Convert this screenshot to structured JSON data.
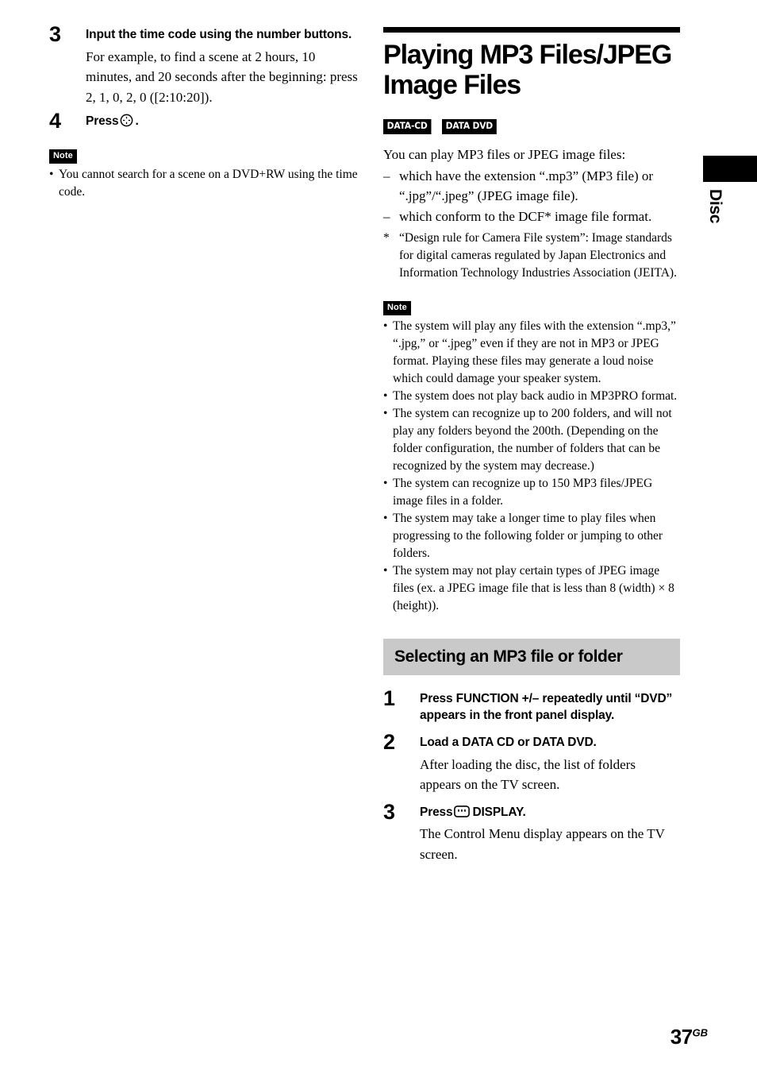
{
  "page": {
    "number": "37",
    "number_suffix": "GB"
  },
  "side_tab": {
    "label": "Disc"
  },
  "left_column": {
    "steps": [
      {
        "number": "3",
        "title": "Input the time code using the number buttons.",
        "body": "For example, to find a scene at 2 hours, 10 minutes, and 20 seconds after the beginning: press 2, 1, 0, 2, 0 ([2:10:20])."
      },
      {
        "number": "4",
        "title_prefix": "Press",
        "title_suffix": ".",
        "icon": "enter-button-icon"
      }
    ],
    "note": {
      "badge": "Note",
      "items": [
        "You cannot search for a scene on a DVD+RW using the time code."
      ]
    }
  },
  "right_column": {
    "section_title": "Playing MP3 Files/JPEG Image Files",
    "media_badges": [
      "DATA-CD",
      "DATA DVD"
    ],
    "intro": "You can play MP3 files or JPEG image files:",
    "dash_items": [
      "which have the extension “.mp3” (MP3 file) or “.jpg”/“.jpeg” (JPEG image file).",
      "which conform to the DCF* image file format."
    ],
    "footnote_marker": "*",
    "footnote": "“Design rule for Camera File system”: Image standards for digital cameras regulated by Japan Electronics and Information Technology Industries Association (JEITA).",
    "note": {
      "badge": "Note",
      "items": [
        "The system will play any files with the extension “.mp3,” “.jpg,” or “.jpeg” even if they are not in MP3 or JPEG format. Playing these files may generate a loud noise which could damage your speaker system.",
        "The system does not play back audio in MP3PRO format.",
        "The system can recognize up to 200 folders, and will not play any folders beyond the 200th. (Depending on the folder configuration, the number of folders that can be recognized by the system may decrease.)",
        "The system can recognize up to 150 MP3 files/JPEG image files in a folder.",
        "The system may take a longer time to play files when progressing to the following folder or jumping to other folders.",
        "The system may not play certain types of JPEG image files (ex. a JPEG image file that is less than 8 (width) × 8 (height))."
      ]
    },
    "sub_heading": "Selecting an MP3 file or folder",
    "steps": [
      {
        "number": "1",
        "title": "Press FUNCTION +/– repeatedly until “DVD” appears in the front panel display.",
        "body": ""
      },
      {
        "number": "2",
        "title": "Load a DATA CD or DATA DVD.",
        "body": "After loading the disc, the list of folders appears on the TV screen."
      },
      {
        "number": "3",
        "title_prefix": "Press",
        "title_suffix": "DISPLAY.",
        "icon": "display-button-icon",
        "body": "The Control Menu display appears on the TV screen."
      }
    ]
  },
  "colors": {
    "subheading_background": "#c9c9c9",
    "badge_background": "#000000",
    "text": "#000000"
  }
}
